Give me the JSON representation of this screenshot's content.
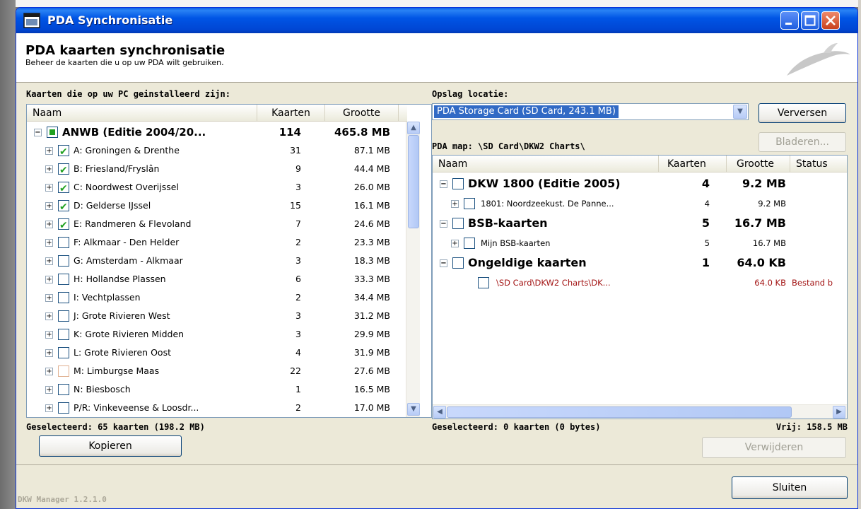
{
  "window": {
    "title": "PDA Synchronisatie"
  },
  "header": {
    "title": "PDA kaarten synchronisatie",
    "subtitle": "Beheer de kaarten die u op uw PDA wilt gebruiken."
  },
  "left": {
    "label": "Kaarten die op uw PC geinstalleerd zijn:",
    "columns": [
      "Naam",
      "Kaarten",
      "Grootte"
    ],
    "group": {
      "name": "ANWB (Editie 2004/20...",
      "count": "114",
      "size": "465.8 MB",
      "check": "partial"
    },
    "items": [
      {
        "name": "A: Groningen & Drenthe",
        "count": "31",
        "size": "87.1 MB",
        "check": "checked"
      },
      {
        "name": "B: Friesland/Fryslân",
        "count": "9",
        "size": "44.4 MB",
        "check": "checked"
      },
      {
        "name": "C: Noordwest Overijssel",
        "count": "3",
        "size": "26.0 MB",
        "check": "checked"
      },
      {
        "name": "D: Gelderse IJssel",
        "count": "15",
        "size": "16.1 MB",
        "check": "checked"
      },
      {
        "name": "E: Randmeren & Flevoland",
        "count": "7",
        "size": "24.6 MB",
        "check": "checked"
      },
      {
        "name": "F: Alkmaar - Den Helder",
        "count": "2",
        "size": "23.3 MB",
        "check": "unchecked"
      },
      {
        "name": "G: Amsterdam - Alkmaar",
        "count": "3",
        "size": "18.3 MB",
        "check": "unchecked"
      },
      {
        "name": "H: Hollandse Plassen",
        "count": "6",
        "size": "33.3 MB",
        "check": "unchecked"
      },
      {
        "name": "I: Vechtplassen",
        "count": "2",
        "size": "34.4 MB",
        "check": "unchecked"
      },
      {
        "name": "J: Grote Rivieren West",
        "count": "3",
        "size": "31.2 MB",
        "check": "unchecked"
      },
      {
        "name": "K: Grote Rivieren Midden",
        "count": "3",
        "size": "29.9 MB",
        "check": "unchecked"
      },
      {
        "name": "L: Grote Rivieren Oost",
        "count": "4",
        "size": "31.9 MB",
        "check": "unchecked"
      },
      {
        "name": "M: Limburgse Maas",
        "count": "22",
        "size": "27.6 MB",
        "check": "unchecked-orange"
      },
      {
        "name": "N: Biesbosch",
        "count": "1",
        "size": "16.5 MB",
        "check": "unchecked"
      },
      {
        "name": "P/R: Vinkeveense & Loosdr...",
        "count": "2",
        "size": "17.0 MB",
        "check": "unchecked"
      }
    ],
    "status": "Geselecteerd: 65 kaarten (198.2 MB)",
    "copy_button": "Kopieren"
  },
  "right": {
    "storage_label": "Opslag locatie:",
    "storage_value": "PDA Storage Card (SD Card, 243.1 MB)",
    "refresh_button": "Verversen",
    "browse_button": "Bladeren...",
    "map_label": "PDA map: \\SD Card\\DKW2 Charts\\",
    "columns": [
      "Naam",
      "Kaarten",
      "Grootte",
      "Status"
    ],
    "rows": [
      {
        "name": "DKW 1800 (Editie 2005)",
        "count": "4",
        "size": "9.2 MB",
        "status": "",
        "kind": "group"
      },
      {
        "name": "1801: Noordzeekust. De Panne...",
        "count": "4",
        "size": "9.2 MB",
        "status": "",
        "kind": "child"
      },
      {
        "name": "BSB-kaarten",
        "count": "5",
        "size": "16.7 MB",
        "status": "",
        "kind": "group"
      },
      {
        "name": "Mijn BSB-kaarten",
        "count": "5",
        "size": "16.7 MB",
        "status": "",
        "kind": "child"
      },
      {
        "name": "Ongeldige kaarten",
        "count": "1",
        "size": "64.0 KB",
        "status": "",
        "kind": "group"
      },
      {
        "name": "\\SD Card\\DKW2 Charts\\DK...",
        "count": "",
        "size": "64.0 KB",
        "status": "Bestand b",
        "kind": "invalid"
      }
    ],
    "status": "Geselecteerd: 0 kaarten (0 bytes)",
    "free": "Vrij: 158.5 MB",
    "delete_button": "Verwijderen"
  },
  "footer": {
    "close_button": "Sluiten",
    "version": "DKW Manager 1.2.1.0"
  },
  "colors": {
    "titlebar": "#0055e5",
    "check_green": "#21a121",
    "selection_blue": "#316ac5",
    "invalid_red": "#a31515"
  }
}
